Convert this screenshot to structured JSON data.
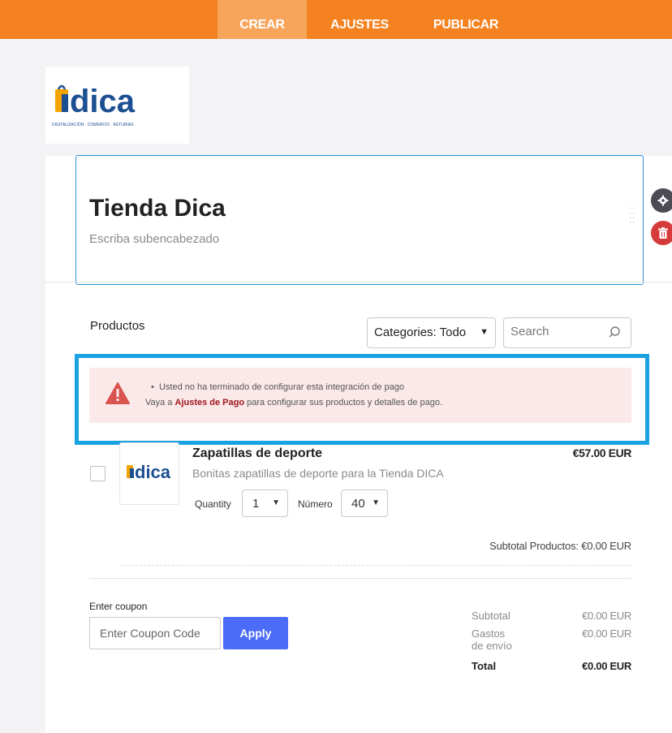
{
  "topbar": {
    "tabs": [
      {
        "label": "CREAR",
        "active": true
      },
      {
        "label": "AJUSTES",
        "active": false
      },
      {
        "label": "PUBLICAR",
        "active": false
      }
    ],
    "color": "#f58220",
    "active_color": "#f8a55c"
  },
  "logo": {
    "text": "dica",
    "tagline": "DIGITALIZACIÓN · COMERCIO · ASTURIAS"
  },
  "header": {
    "title": "Tienda Dica",
    "subtitle": "Escriba subencabezado"
  },
  "side_actions": {
    "settings_icon": "gear-icon",
    "delete_icon": "trash-icon"
  },
  "products_section": {
    "label": "Productos",
    "category_select": "Categories: Todo",
    "search_placeholder": "Search"
  },
  "alert": {
    "line1": "Usted no ha terminado de configurar esta integración de pago",
    "line2_prefix": "Vaya a ",
    "line2_link": "Ajustes de Pago",
    "line2_suffix": " para configurar sus productos y detalles de pago.",
    "icon": "warning-icon"
  },
  "product": {
    "name": "Zapatillas de deporte",
    "description": "Bonitas zapatillas de deporte para la Tienda DICA",
    "price": "€57.00 EUR",
    "quantity_label": "Quantity",
    "quantity_value": "1",
    "number_label": "Número",
    "number_value": "40"
  },
  "subtotal_products": "Subtotal Productos:  €0.00 EUR",
  "coupon": {
    "label": "Enter coupon",
    "placeholder": "Enter Coupon Code",
    "button": "Apply"
  },
  "totals": {
    "subtotal_label": "Subtotal",
    "subtotal_value": "€0.00 EUR",
    "shipping_label_1": "Gastos",
    "shipping_label_2": "de envío",
    "shipping_value": "€0.00 EUR",
    "total_label": "Total",
    "total_value": "€0.00 EUR"
  }
}
